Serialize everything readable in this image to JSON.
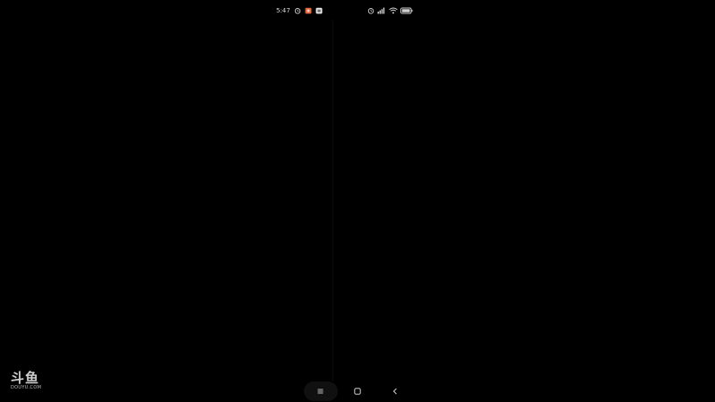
{
  "status_bar": {
    "time": "5:47",
    "left_icons": [
      "alarm-icon",
      "app-notification-icon",
      "app-badge-icon"
    ],
    "right_icons": [
      "alarm-icon",
      "signal-icon",
      "wifi-icon",
      "battery-icon"
    ]
  },
  "nav_bar": {
    "buttons": [
      "menu-button",
      "home-button",
      "back-button"
    ]
  },
  "watermark": {
    "main": "斗鱼",
    "sub": "DOUYU.COM"
  },
  "colors": {
    "background": "#000000",
    "status_text": "#d8d8d8",
    "accent_badge": "#e0643c"
  }
}
